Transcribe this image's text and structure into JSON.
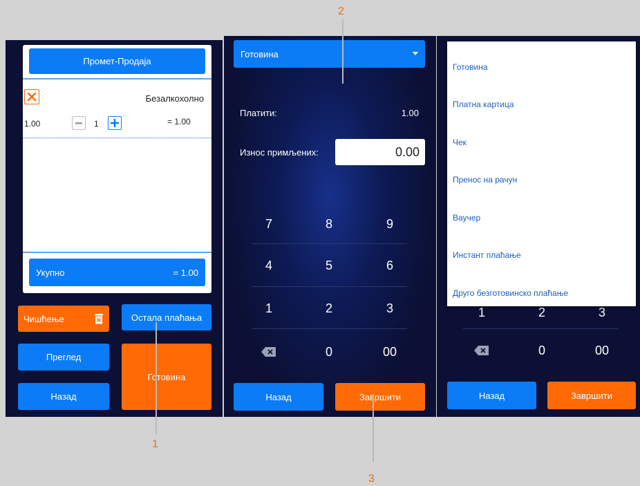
{
  "screen1": {
    "header_button": "Промет-Продаја",
    "item": {
      "name": "Безалкохолно",
      "price": "1.00",
      "quantity": "1",
      "line_total": "= 1.00"
    },
    "total": {
      "label": "Укупно",
      "value": "= 1.00"
    },
    "buttons": {
      "clear": "Чишћење",
      "other_payments": "Остала плаћања",
      "review": "Преглед",
      "back": "Назад",
      "cash": "Готовина"
    }
  },
  "screen2": {
    "payment_select": "Готовина",
    "to_pay_label": "Платити:",
    "to_pay_value": "1.00",
    "received_label": "Износ примљених:",
    "received_value": "0.00",
    "keypad": [
      [
        "7",
        "8",
        "9"
      ],
      [
        "4",
        "5",
        "6"
      ],
      [
        "1",
        "2",
        "3"
      ],
      [
        "",
        "0",
        "00"
      ]
    ],
    "back": "Назад",
    "finish": "Завршити"
  },
  "screen3": {
    "payment_options": [
      "Готовина",
      "Платна картица",
      "Чек",
      "Пренос на рачун",
      "Ваучер",
      "Инстант плаћање",
      "Друго безготовинско плаћање"
    ],
    "keypad_partial": [
      "1",
      "2",
      "3"
    ],
    "keypad_last": [
      "",
      "0",
      "00"
    ],
    "back": "Назад",
    "finish": "Завршити"
  },
  "callouts": [
    "1",
    "2",
    "3"
  ],
  "colors": {
    "accent_blue": "#0b7cf6",
    "accent_orange": "#ff6a06",
    "navy": "#0b1034",
    "callout": "#e8730b"
  }
}
